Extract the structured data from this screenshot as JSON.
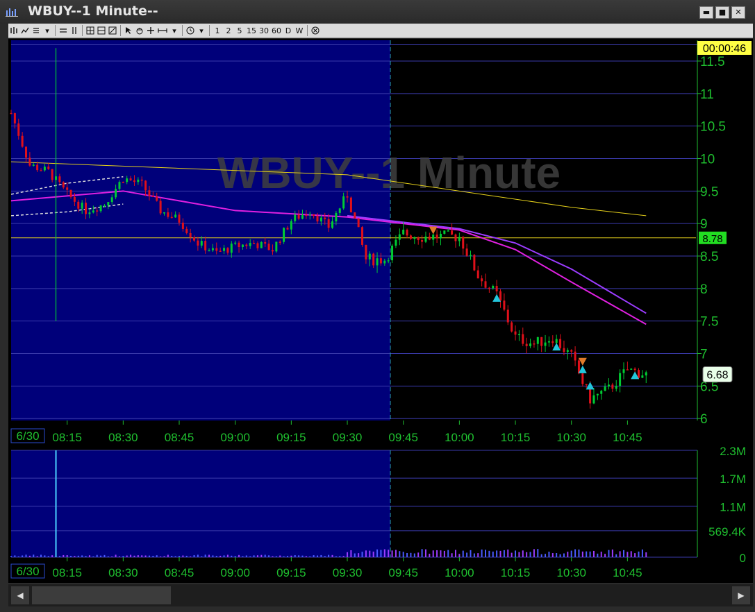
{
  "window": {
    "title": "WBUY--1 Minute--",
    "min_glyph": "▬",
    "max_glyph": "■",
    "close_glyph": "✕"
  },
  "toolbar": {
    "timeframes": [
      "1",
      "2",
      "5",
      "15",
      "30",
      "60",
      "D",
      "W"
    ]
  },
  "chart": {
    "watermark": "WBUY--1 Minute",
    "countdown": "00:00:46",
    "price_ticks": [
      "11.5",
      "11",
      "10.5",
      "10",
      "9.5",
      "9",
      "8.5",
      "8",
      "7.5",
      "7",
      "6.5",
      "6"
    ],
    "volume_ticks": [
      "2.3M",
      "1.7M",
      "1.1M",
      "569.4K",
      "0"
    ],
    "time_ticks": [
      "08:15",
      "08:30",
      "08:45",
      "09:00",
      "09:15",
      "09:30",
      "09:45",
      "10:00",
      "10:15",
      "10:30",
      "10:45"
    ],
    "date_label": "6/30",
    "price_labels": {
      "level_line": "8.78",
      "last_price": "6.68"
    },
    "colors": {
      "premarket_bg": "#00007a",
      "up": "#00cc33",
      "down": "#e0101a",
      "ma_yellow": "#e6d11a",
      "ma_magenta": "#e020e0",
      "ma_purple": "#9b3cff",
      "grid": "#3a3aaa",
      "axis_text": "#1fbf2f",
      "buy_marker": "#22c6dc",
      "sell_marker": "#e07a2a"
    }
  },
  "chart_data": {
    "type": "candlestick",
    "title": "WBUY--1 Minute",
    "date": "6/30",
    "x_ticks": [
      "08:15",
      "08:30",
      "08:45",
      "09:00",
      "09:15",
      "09:30",
      "09:45",
      "10:00",
      "10:15",
      "10:30",
      "10:45"
    ],
    "ylim": [
      5.97,
      11.82
    ],
    "session_open": "09:30",
    "levels": [
      {
        "label": "8.78",
        "value": 8.78
      }
    ],
    "last_price": 6.68,
    "countdown": "00:00:46",
    "volume_ylim": [
      0,
      2300000
    ],
    "volume_ticks": [
      "2.3M",
      "1.7M",
      "1.1M",
      "569.4K",
      "0"
    ],
    "trend": [
      {
        "t": "08:00",
        "p": 10.7
      },
      {
        "t": "08:05",
        "p": 9.9
      },
      {
        "t": "08:10",
        "p": 9.8
      },
      {
        "t": "08:15",
        "p": 9.45
      },
      {
        "t": "08:20",
        "p": 9.2
      },
      {
        "t": "08:25",
        "p": 9.3
      },
      {
        "t": "08:30",
        "p": 9.7
      },
      {
        "t": "08:35",
        "p": 9.6
      },
      {
        "t": "08:40",
        "p": 9.2
      },
      {
        "t": "08:45",
        "p": 9.05
      },
      {
        "t": "08:50",
        "p": 8.7
      },
      {
        "t": "08:55",
        "p": 8.55
      },
      {
        "t": "09:00",
        "p": 8.65
      },
      {
        "t": "09:05",
        "p": 8.7
      },
      {
        "t": "09:10",
        "p": 8.6
      },
      {
        "t": "09:15",
        "p": 9.05
      },
      {
        "t": "09:20",
        "p": 9.2
      },
      {
        "t": "09:25",
        "p": 8.95
      },
      {
        "t": "09:30",
        "p": 9.45
      },
      {
        "t": "09:35",
        "p": 8.45
      },
      {
        "t": "09:40",
        "p": 8.45
      },
      {
        "t": "09:45",
        "p": 8.85
      },
      {
        "t": "09:50",
        "p": 8.8
      },
      {
        "t": "09:55",
        "p": 8.8
      },
      {
        "t": "10:00",
        "p": 8.8
      },
      {
        "t": "10:05",
        "p": 8.2
      },
      {
        "t": "10:10",
        "p": 7.9
      },
      {
        "t": "10:15",
        "p": 7.25
      },
      {
        "t": "10:20",
        "p": 7.15
      },
      {
        "t": "10:25",
        "p": 7.25
      },
      {
        "t": "10:30",
        "p": 6.95
      },
      {
        "t": "10:35",
        "p": 6.3
      },
      {
        "t": "10:40",
        "p": 6.45
      },
      {
        "t": "10:45",
        "p": 6.75
      },
      {
        "t": "10:50",
        "p": 6.68
      }
    ],
    "moving_averages": [
      {
        "color": "yellow",
        "points": [
          {
            "t": "08:00",
            "p": 9.95
          },
          {
            "t": "09:30",
            "p": 9.75
          },
          {
            "t": "10:00",
            "p": 9.5
          },
          {
            "t": "10:30",
            "p": 9.25
          },
          {
            "t": "10:50",
            "p": 9.12
          }
        ]
      },
      {
        "color": "magenta",
        "points": [
          {
            "t": "08:00",
            "p": 9.35
          },
          {
            "t": "08:30",
            "p": 9.5
          },
          {
            "t": "09:00",
            "p": 9.2
          },
          {
            "t": "09:30",
            "p": 9.1
          },
          {
            "t": "10:00",
            "p": 8.9
          },
          {
            "t": "10:15",
            "p": 8.6
          },
          {
            "t": "10:30",
            "p": 8.1
          },
          {
            "t": "10:50",
            "p": 7.45
          }
        ]
      },
      {
        "color": "purple",
        "points": [
          {
            "t": "09:30",
            "p": 9.12
          },
          {
            "t": "10:00",
            "p": 8.92
          },
          {
            "t": "10:15",
            "p": 8.7
          },
          {
            "t": "10:30",
            "p": 8.3
          },
          {
            "t": "10:50",
            "p": 7.62
          }
        ]
      }
    ],
    "buy_markers": [
      {
        "t": "10:10",
        "p": 7.85
      },
      {
        "t": "10:26",
        "p": 7.1
      },
      {
        "t": "10:33",
        "p": 6.75
      },
      {
        "t": "10:35",
        "p": 6.5
      },
      {
        "t": "10:47",
        "p": 6.66
      }
    ],
    "sell_markers": [
      {
        "t": "09:53",
        "p": 8.9
      },
      {
        "t": "10:33",
        "p": 6.88
      }
    ]
  }
}
